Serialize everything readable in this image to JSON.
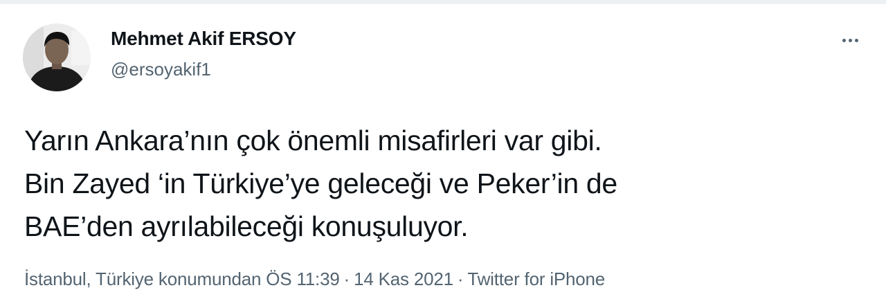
{
  "author": {
    "name": "Mehmet Akif ERSOY",
    "handle": "@ersoyakif1"
  },
  "tweet": {
    "lines": [
      "Yarın Ankara’nın çok önemli misafirleri var gibi.",
      "Bin Zayed ‘in Türkiye’ye geleceği ve Peker’in de",
      "BAE’den ayrılabileceği konuşuluyor."
    ]
  },
  "meta": {
    "location": "İstanbul, Türkiye konumundan",
    "time": "ÖS 11:39",
    "date": "14 Kas 2021",
    "source": "Twitter for iPhone",
    "separator": "·"
  },
  "icons": {
    "more": "more-horizontal-icon"
  }
}
